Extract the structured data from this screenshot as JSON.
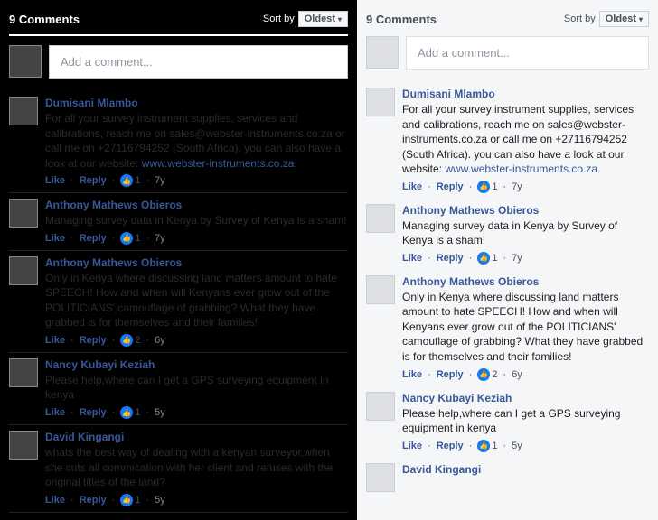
{
  "sort_label": "Sort by",
  "sort_value": "Oldest",
  "compose_placeholder": "Add a comment...",
  "like_label": "Like",
  "reply_label": "Reply",
  "link_text": "www.webster-instruments.co.za",
  "panels": [
    {
      "theme": "dark",
      "count_label": "9 Comments",
      "comments": [
        {
          "author": "Dumisani Mlambo",
          "text_before": "For all your survey instrument supplies, services and calibrations, reach me on sales@webster-instruments.co.za or call me on +27116794252 (South Africa). you can also have a look at our website: ",
          "has_link": true,
          "likes": "1",
          "time": "7y"
        },
        {
          "author": "Anthony Mathews Obieros",
          "text_before": "Managing survey data in Kenya by Survey of Kenya is a sham!",
          "has_link": false,
          "likes": "1",
          "time": "7y"
        },
        {
          "author": "Anthony Mathews Obieros",
          "text_before": "Only in Kenya where discussing land matters amount to hate SPEECH! How and when will Kenyans ever grow out of the POLITICIANS' camouflage of grabbing? What they have grabbed is for themselves and their families!",
          "has_link": false,
          "likes": "2",
          "time": "6y"
        },
        {
          "author": "Nancy Kubayi Keziah",
          "text_before": "Please help,where can I get a GPS surveying equipment in kenya",
          "has_link": false,
          "likes": "1",
          "time": "5y"
        },
        {
          "author": "David Kingangi",
          "text_before": "whats the best way of dealing with a kenyan surveyor,when she cuts all commication with her client and refuses with the original titles of the land?",
          "has_link": false,
          "likes": "1",
          "time": "5y"
        }
      ]
    },
    {
      "theme": "light",
      "count_label": "9 Comments",
      "comments": [
        {
          "author": "Dumisani Mlambo",
          "text_before": "For all your survey instrument supplies, services and calibrations, reach me on sales@webster-instruments.co.za or call me on +27116794252 (South Africa). you can also have a look at our website: ",
          "has_link": true,
          "likes": "1",
          "time": "7y"
        },
        {
          "author": "Anthony Mathews Obieros",
          "text_before": "Managing survey data in Kenya by Survey of Kenya is a sham!",
          "has_link": false,
          "likes": "1",
          "time": "7y"
        },
        {
          "author": "Anthony Mathews Obieros",
          "text_before": "Only in Kenya where discussing land matters amount to hate SPEECH! How and when will Kenyans ever grow out of the POLITICIANS' camouflage of grabbing? What they have grabbed is for themselves and their families!",
          "has_link": false,
          "likes": "2",
          "time": "6y"
        },
        {
          "author": "Nancy Kubayi Keziah",
          "text_before": "Please help,where can I get a GPS surveying equipment in kenya",
          "has_link": false,
          "likes": "1",
          "time": "5y"
        },
        {
          "author": "David Kingangi",
          "text_before": "",
          "has_link": false,
          "likes": "",
          "time": ""
        }
      ]
    }
  ]
}
